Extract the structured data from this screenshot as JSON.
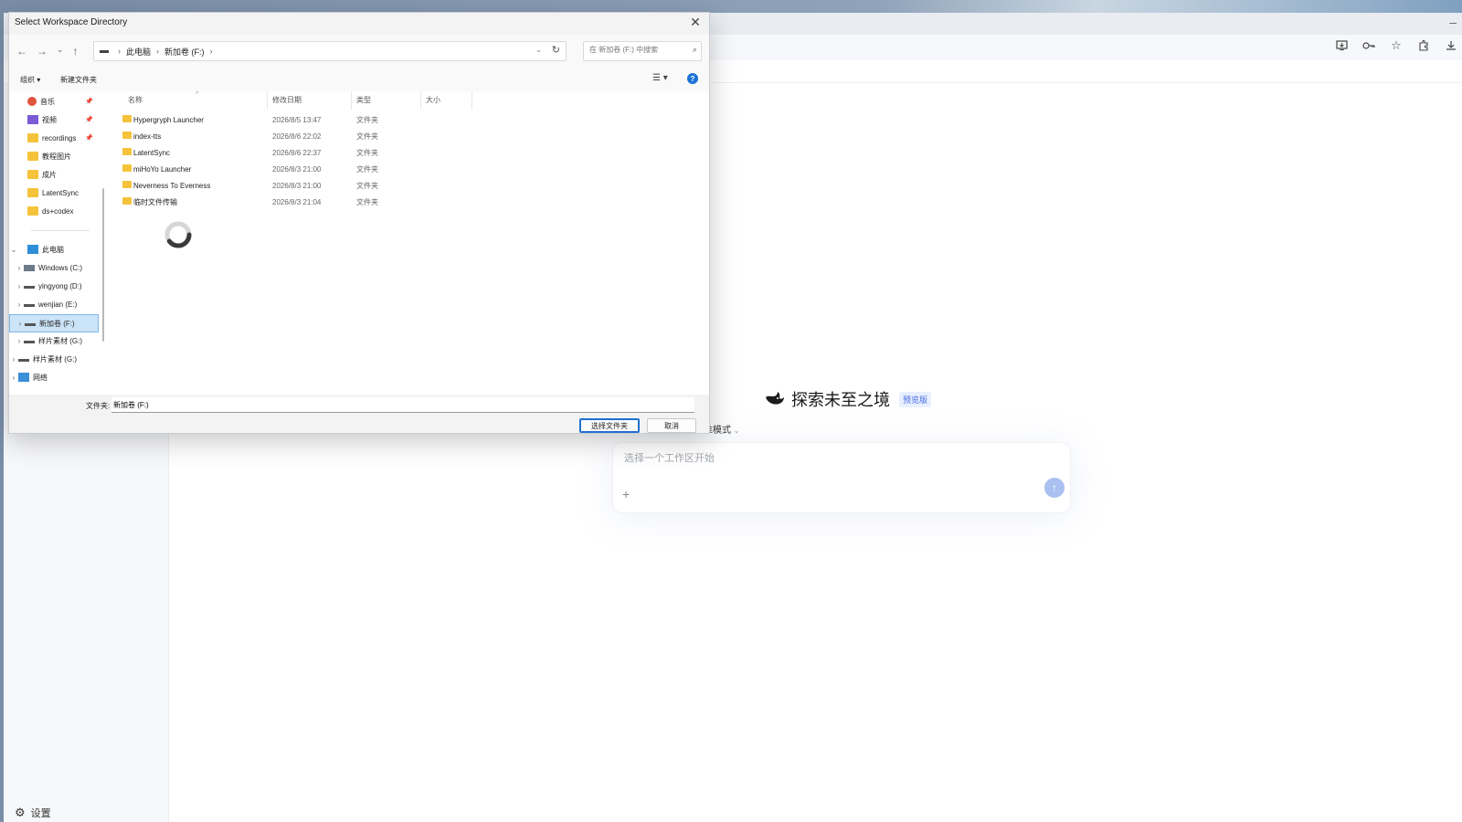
{
  "desktop": {},
  "browser": {
    "toolbar_icons": [
      "install-app-icon",
      "key-icon",
      "star-icon",
      "extensions-icon",
      "download-icon"
    ],
    "minimize_glyph": "–"
  },
  "app": {
    "settings_label": "设置",
    "hero_title": "探索未至之境",
    "hero_badge": "预览版",
    "mode_label": "准模式",
    "chat_placeholder": "选择一个工作区开始",
    "plus_glyph": "+",
    "send_glyph": "↑"
  },
  "dialog": {
    "title": "Select Workspace Directory",
    "close_glyph": "✕",
    "breadcrumb": [
      "此电脑",
      "新加卷 (F:)"
    ],
    "search_placeholder": "在 新加卷 (F:) 中搜索",
    "commands": {
      "organize": "组织 ▾",
      "new_folder": "新建文件夹"
    },
    "columns": {
      "name": "名称",
      "modified": "修改日期",
      "type": "类型",
      "size": "大小"
    },
    "nav_quick": [
      {
        "label": "音乐",
        "pinned": true,
        "icon": "music-icon"
      },
      {
        "label": "视频",
        "pinned": true,
        "icon": "video-icon"
      },
      {
        "label": "recordings",
        "pinned": true,
        "icon": "folder-icon"
      },
      {
        "label": "教程图片",
        "pinned": false,
        "icon": "folder-icon"
      },
      {
        "label": "成片",
        "pinned": false,
        "icon": "folder-icon"
      },
      {
        "label": "LatentSync",
        "pinned": false,
        "icon": "folder-icon"
      },
      {
        "label": "ds+codex",
        "pinned": false,
        "icon": "folder-icon"
      }
    ],
    "nav_tree": [
      {
        "label": "此电脑",
        "expanded": true,
        "icon": "pc-icon"
      },
      {
        "label": "Windows (C:)",
        "icon": "drive-icon"
      },
      {
        "label": "yingyong (D:)",
        "icon": "drive-icon"
      },
      {
        "label": "wenjian (E:)",
        "icon": "drive-icon"
      },
      {
        "label": "新加卷 (F:)",
        "icon": "drive-icon",
        "selected": true
      },
      {
        "label": "样片素材 (G:)",
        "icon": "drive-icon"
      },
      {
        "label": "样片素材 (G:)",
        "icon": "drive-icon"
      },
      {
        "label": "网络",
        "icon": "network-icon"
      }
    ],
    "files": [
      {
        "name": "Hypergryph Launcher",
        "modified": "2026/8/5 13:47",
        "type": "文件夹"
      },
      {
        "name": "index-tts",
        "modified": "2026/8/6 22:02",
        "type": "文件夹"
      },
      {
        "name": "LatentSync",
        "modified": "2026/8/6 22:37",
        "type": "文件夹"
      },
      {
        "name": "miHoYo Launcher",
        "modified": "2026/8/3 21:00",
        "type": "文件夹"
      },
      {
        "name": "Neverness To Everness",
        "modified": "2026/8/3 21:00",
        "type": "文件夹"
      },
      {
        "name": "临时文件传输",
        "modified": "2026/8/3 21:04",
        "type": "文件夹"
      }
    ],
    "folder_label": "文件夹:",
    "folder_value": "新加卷 (F:)",
    "select_button": "选择文件夹",
    "cancel_button": "取消"
  }
}
